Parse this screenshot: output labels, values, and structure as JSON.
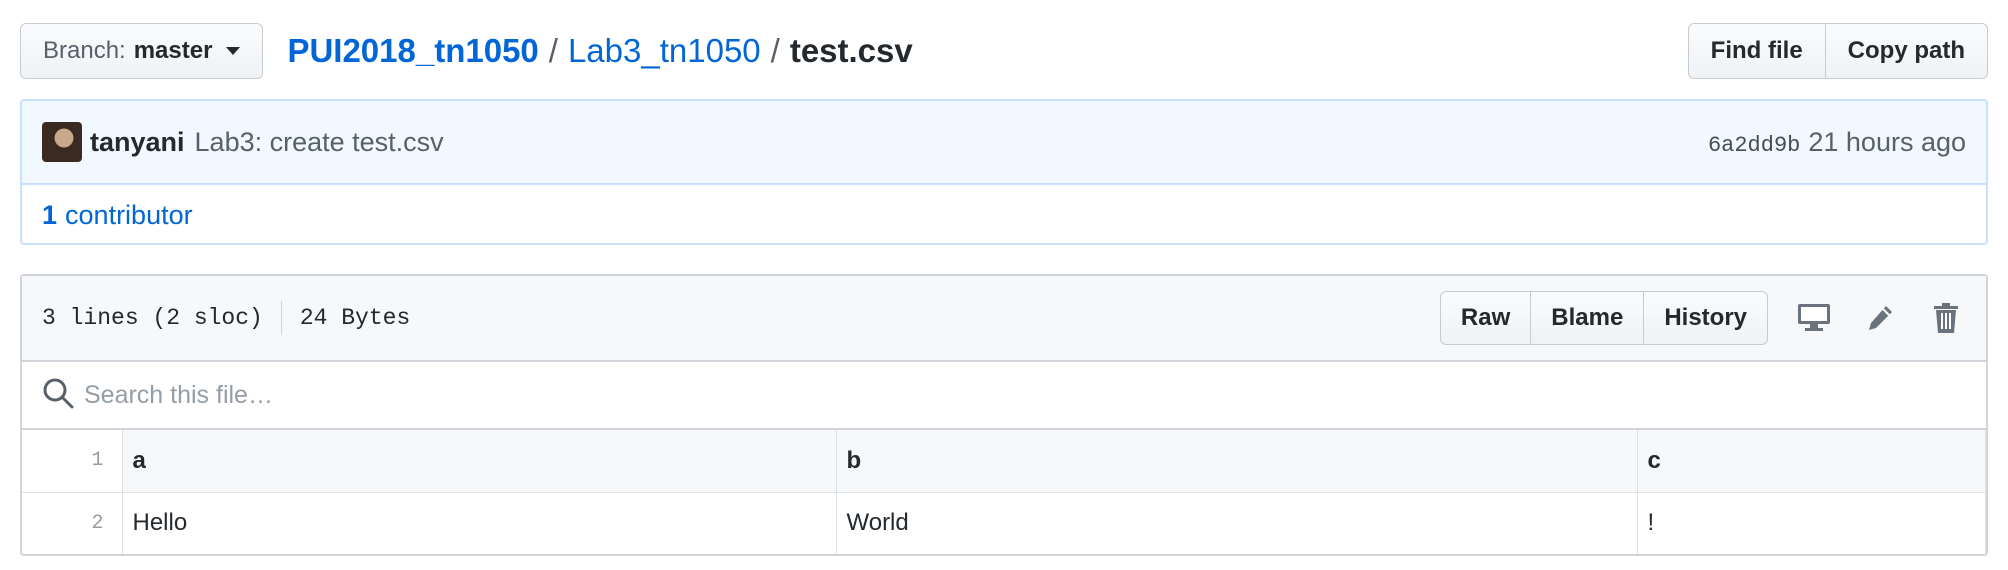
{
  "branch": {
    "label": "Branch:",
    "name": "master"
  },
  "breadcrumb": {
    "repo": "PUI2018_tn1050",
    "folder": "Lab3_tn1050",
    "file": "test.csv",
    "separator": "/"
  },
  "file_nav": {
    "find_file": "Find file",
    "copy_path": "Copy path"
  },
  "commit": {
    "author": "tanyani",
    "message": "Lab3: create test.csv",
    "sha": "6a2dd9b",
    "time": "21 hours ago",
    "contributors_count": "1",
    "contributors_label": "contributor"
  },
  "file": {
    "lines": "3 lines (2 sloc)",
    "size": "24 Bytes",
    "actions": {
      "raw": "Raw",
      "blame": "Blame",
      "history": "History"
    },
    "icons": {
      "display": "desktop-icon",
      "edit": "pencil-icon",
      "delete": "trash-icon",
      "search": "search-icon"
    },
    "search_placeholder": "Search this file…",
    "table": {
      "line_numbers": [
        "1",
        "2"
      ],
      "header": [
        "a",
        "b",
        "c"
      ],
      "rows": [
        [
          "Hello",
          "World",
          "!"
        ]
      ]
    }
  },
  "colors": {
    "link": "#0366d6",
    "commit_bg": "#f1f8ff",
    "border": "#d1d5da"
  }
}
